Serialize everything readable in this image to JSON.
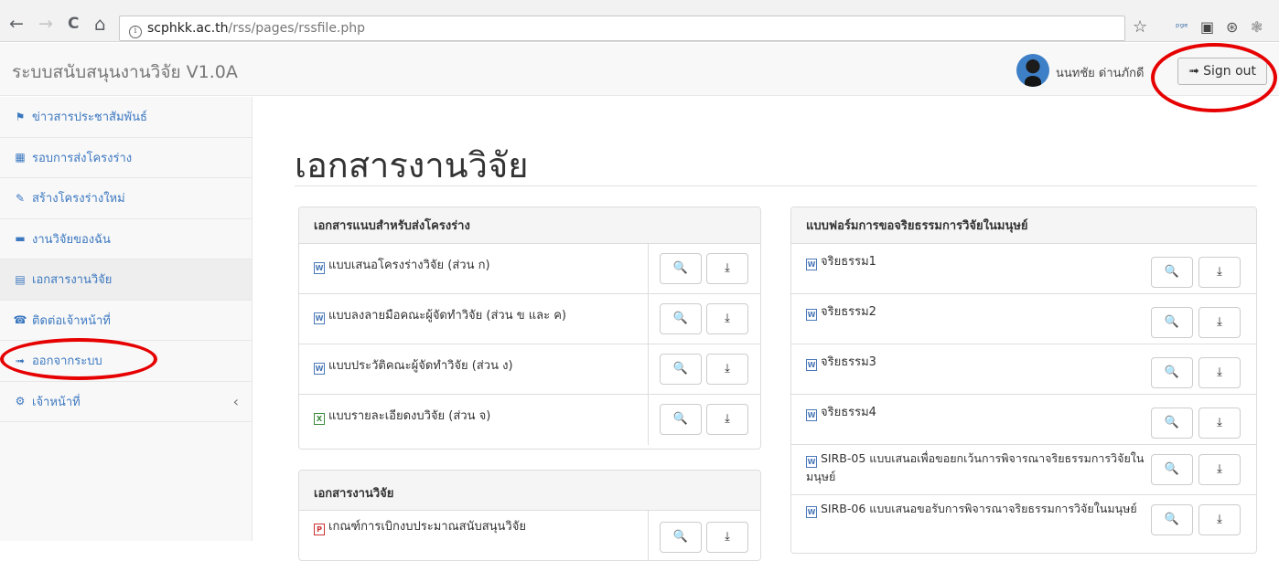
{
  "browser": {
    "back_glyph": "←",
    "forward_glyph": "→",
    "reload_glyph": "C",
    "home_glyph": "⌂",
    "info_glyph": "i",
    "url_host": "scphkk.ac.th",
    "url_path": "/rss/pages/rssfile.php",
    "star_glyph": "☆",
    "ext_glyphs": [
      "ᵖᵍᵉ",
      "▣",
      "⊛",
      "❃"
    ]
  },
  "header": {
    "brand": "ระบบสนับสนุนงานวิจัย V1.0A",
    "user_name": "นนทชัย ด่านภักดี",
    "signout_icon": "➟",
    "signout_label": "Sign out"
  },
  "sidebar": {
    "items": [
      {
        "icon": "⚑",
        "label": "ข่าวสารประชาสัมพันธ์"
      },
      {
        "icon": "▦",
        "label": "รอบการส่งโครงร่าง"
      },
      {
        "icon": "✎",
        "label": "สร้างโครงร่างใหม่"
      },
      {
        "icon": "▬",
        "label": "งานวิจัยของฉัน"
      },
      {
        "icon": "▤",
        "label": "เอกสารงานวิจัย"
      },
      {
        "icon": "☎",
        "label": "ติดต่อเจ้าหน้าที่"
      },
      {
        "icon": "➟",
        "label": "ออกจากระบบ"
      },
      {
        "icon": "⚙",
        "label": "เจ้าหน้าที่",
        "chevron": "‹"
      }
    ]
  },
  "main": {
    "title": "เอกสารงานวิจัย",
    "view_icon": "🔍",
    "download_icon": "⤓",
    "panel_proposal": {
      "heading": "เอกสารแนบสำหรับส่งโครงร่าง",
      "rows": [
        {
          "type": "W",
          "name": "แบบเสนอโครงร่างวิจัย (ส่วน ก)"
        },
        {
          "type": "W",
          "name": "แบบลงลายมือคณะผู้จัดทำวิจัย (ส่วน ข และ ค)"
        },
        {
          "type": "W",
          "name": "แบบประวัติคณะผู้จัดทำวิจัย (ส่วน ง)"
        },
        {
          "type": "X",
          "name": "แบบรายละเอียดงบวิจัย (ส่วน จ)"
        }
      ]
    },
    "panel_research": {
      "heading": "เอกสารงานวิจัย",
      "rows": [
        {
          "type": "P",
          "name": "เกณฑ์การเบิกงบประมาณสนับสนุนวิจัย"
        }
      ]
    },
    "panel_ethics": {
      "heading": "แบบฟอร์มการขอจริยธรรมการวิจัยในมนุษย์",
      "rows": [
        {
          "type": "W",
          "name": "จริยธรรม1"
        },
        {
          "type": "W",
          "name": "จริยธรรม2"
        },
        {
          "type": "W",
          "name": "จริยธรรม3"
        },
        {
          "type": "W",
          "name": "จริยธรรม4"
        },
        {
          "type": "W",
          "name": "SIRB-05 แบบเสนอเพื่อขอยกเว้นการพิจารณาจริยธรรมการวิจัยในมนุษย์"
        },
        {
          "type": "W",
          "name": "SIRB-06 แบบเสนอขอรับการพิจารณาจริยธรรมการวิจัยในมนุษย์"
        }
      ]
    }
  },
  "colors": {
    "link": "#3c78c0",
    "annotation_ring": "#e60000"
  }
}
